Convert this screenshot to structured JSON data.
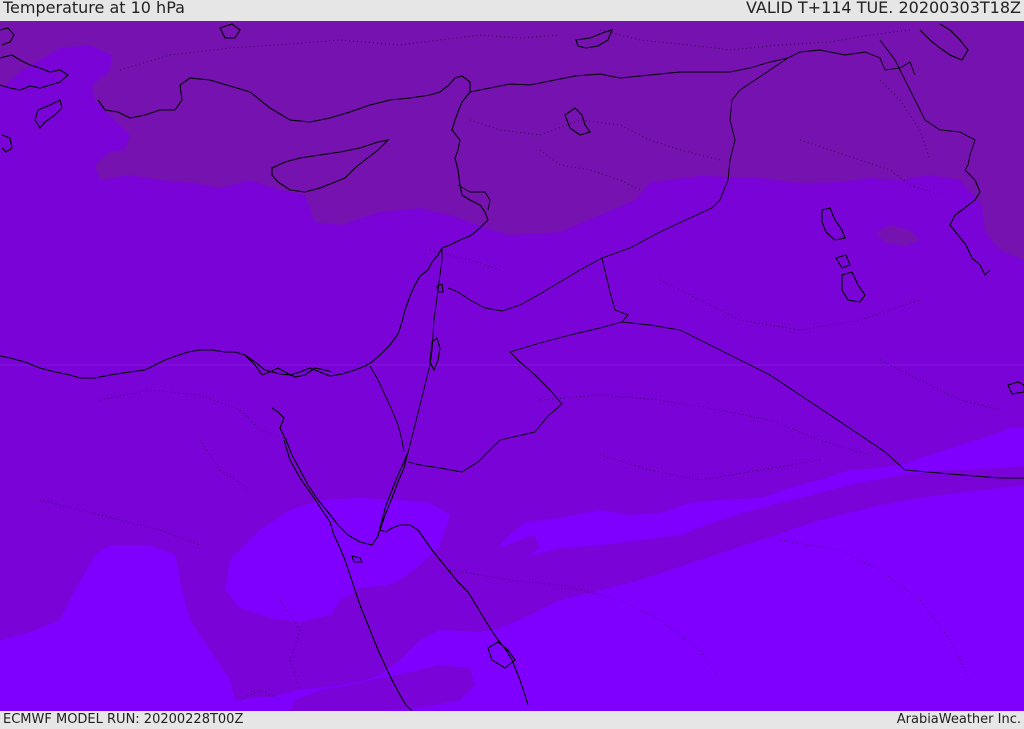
{
  "header": {
    "title": "Temperature at 10 hPa",
    "valid_time": "VALID T+114 TUE. 20200303T18Z"
  },
  "footer": {
    "model_run": "ECMWF MODEL RUN: 20200228T00Z",
    "credit": "ArabiaWeather Inc."
  },
  "map": {
    "region": "Eastern Mediterranean and Middle East",
    "field_colors": {
      "cold_band": "#7612b0",
      "mid_band": "#7a04d8",
      "warm_band": "#7f00ff"
    },
    "coastline_color": "#000000",
    "border_style": "solid",
    "admin_boundary_style": "dotted"
  }
}
